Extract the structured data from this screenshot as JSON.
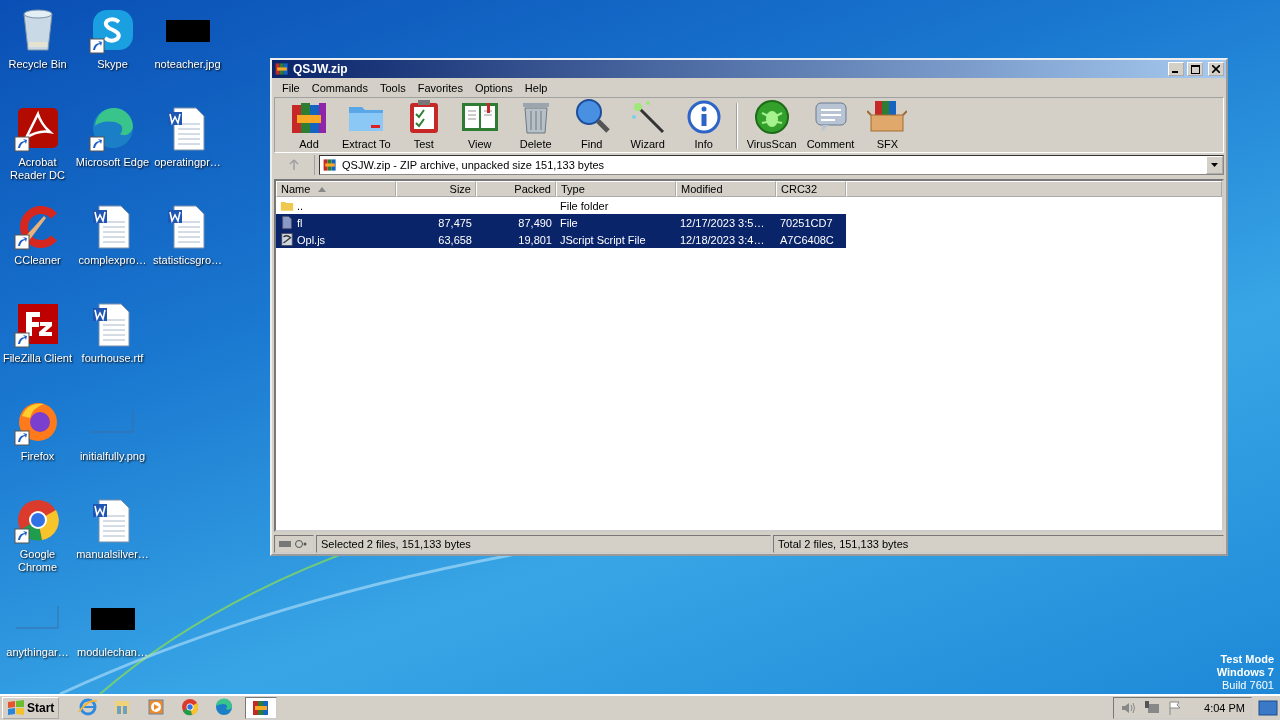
{
  "desktop": {
    "icons": [
      {
        "label": "Recycle Bin",
        "kind": "recycle",
        "shortcut": false
      },
      {
        "label": "Acrobat Reader DC",
        "kind": "acrobat",
        "shortcut": true
      },
      {
        "label": "CCleaner",
        "kind": "ccleaner",
        "shortcut": true
      },
      {
        "label": "FileZilla Client",
        "kind": "filezilla",
        "shortcut": true
      },
      {
        "label": "Firefox",
        "kind": "firefox",
        "shortcut": true
      },
      {
        "label": "Google Chrome",
        "kind": "chrome",
        "shortcut": true
      },
      {
        "label": "anythingar…",
        "kind": "blankimage",
        "shortcut": false
      },
      {
        "label": "Skype",
        "kind": "skype",
        "shortcut": true
      },
      {
        "label": "Microsoft Edge",
        "kind": "edge",
        "shortcut": true
      },
      {
        "label": "complexpro…",
        "kind": "word",
        "shortcut": false
      },
      {
        "label": "fourhouse.rtf",
        "kind": "word",
        "shortcut": false
      },
      {
        "label": "initialfully.png",
        "kind": "blankimage",
        "shortcut": false
      },
      {
        "label": "manualsilver…",
        "kind": "word",
        "shortcut": false
      },
      {
        "label": "modulechan…",
        "kind": "blackimage",
        "shortcut": false
      },
      {
        "label": "noteacher.jpg",
        "kind": "blackimage",
        "shortcut": false
      },
      {
        "label": "operatingpr…",
        "kind": "word",
        "shortcut": false
      },
      {
        "label": "statisticsgro…",
        "kind": "word",
        "shortcut": false
      }
    ],
    "watermark_lines": [
      "Test Mode",
      "Windows 7",
      "Build 7601"
    ]
  },
  "window": {
    "title": "QSJW.zip",
    "menu": [
      "File",
      "Commands",
      "Tools",
      "Favorites",
      "Options",
      "Help"
    ],
    "toolbar": [
      {
        "label": "Add",
        "kind": "add"
      },
      {
        "label": "Extract To",
        "kind": "extract"
      },
      {
        "label": "Test",
        "kind": "test"
      },
      {
        "label": "View",
        "kind": "view"
      },
      {
        "label": "Delete",
        "kind": "delete"
      },
      {
        "label": "Find",
        "kind": "find"
      },
      {
        "label": "Wizard",
        "kind": "wizard"
      },
      {
        "label": "Info",
        "kind": "info"
      },
      {
        "label": "VirusScan",
        "kind": "virusscan"
      },
      {
        "label": "Comment",
        "kind": "comment"
      },
      {
        "label": "SFX",
        "kind": "sfx"
      }
    ],
    "address": "QSJW.zip - ZIP archive, unpacked size 151,133 bytes",
    "table": {
      "columns": [
        {
          "label": "Name",
          "sorted": true
        },
        {
          "label": "Size",
          "sorted": false
        },
        {
          "label": "Packed",
          "sorted": false
        },
        {
          "label": "Type",
          "sorted": false
        },
        {
          "label": "Modified",
          "sorted": false
        },
        {
          "label": "CRC32",
          "sorted": false
        }
      ],
      "rows": [
        {
          "kind": "folder",
          "selected": false,
          "cells": [
            "..",
            "",
            "",
            "File folder",
            "",
            ""
          ]
        },
        {
          "kind": "file",
          "selected": true,
          "cells": [
            "fl",
            "87,475",
            "87,490",
            "File",
            "12/17/2023 3:5…",
            "70251CD7"
          ]
        },
        {
          "kind": "script",
          "selected": true,
          "cells": [
            "Opl.js",
            "63,658",
            "19,801",
            "JScript Script File",
            "12/18/2023 3:4…",
            "A7C6408C"
          ]
        }
      ]
    },
    "status_bar": {
      "selection": "Selected 2 files, 151,133 bytes",
      "total": "Total 2 files, 151,133 bytes"
    }
  },
  "taskbar": {
    "start": "Start",
    "pinned": [
      {
        "kind": "ie",
        "active": false
      },
      {
        "kind": "explorer",
        "active": false
      },
      {
        "kind": "media",
        "active": false
      },
      {
        "kind": "chrome",
        "active": false
      },
      {
        "kind": "edge",
        "active": false
      },
      {
        "kind": "winrar",
        "active": true
      }
    ],
    "clock": "4:04 PM"
  }
}
